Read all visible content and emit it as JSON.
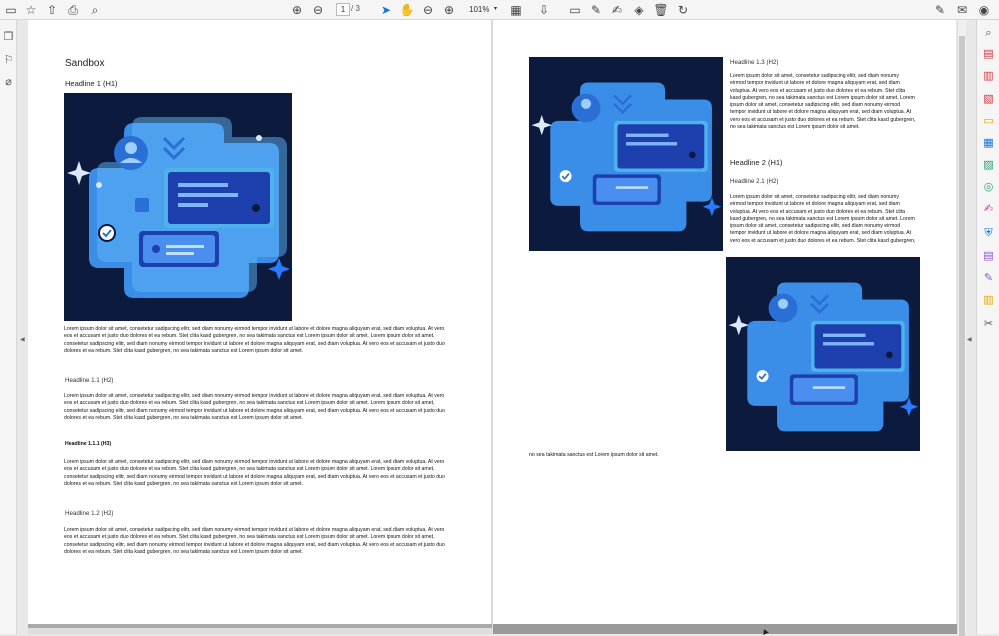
{
  "toolbar": {
    "page_current": "1",
    "page_total": "/ 3",
    "zoom": "101%",
    "zoom_caret": "▾",
    "icons": [
      "save-icon",
      "bookmark-star-icon",
      "upload-icon",
      "print-icon",
      "search-icon",
      "page-up-icon",
      "page-down-icon",
      "select-pointer-icon",
      "hand-tool-icon",
      "zoom-out-icon",
      "zoom-in-icon",
      "fit-page-icon",
      "scroll-mode-icon",
      "comment-icon",
      "highlight-pen-icon",
      "sign-icon",
      "stamp-icon",
      "delete-icon",
      "rotate-icon",
      "edit-sign-icon",
      "email-icon",
      "account-icon"
    ]
  },
  "left_panel": {
    "icons": [
      "pages-icon",
      "bookmarks-icon",
      "attachments-icon"
    ],
    "collapse_glyph": "◀"
  },
  "right_rail": {
    "icons": [
      "zoom-tool-icon",
      "create-pdf-icon",
      "combine-files-icon",
      "export-pdf-icon",
      "comment-tool-icon",
      "organize-pages-icon",
      "edit-pdf-icon",
      "scan-icon",
      "fill-sign-icon",
      "protect-icon",
      "send-for-signature-icon",
      "request-signature-icon",
      "compare-icon",
      "more-tools-icon"
    ],
    "colors": [
      "#555555",
      "#d7373f",
      "#d7373f",
      "#d7373f",
      "#e8a600",
      "#1473e6",
      "#2d9d78",
      "#2d9d78",
      "#d83790",
      "#1473e6",
      "#9256d9",
      "#9256d9",
      "#e8a600",
      "#555555"
    ],
    "collapse_glyph": "◀"
  },
  "page1": {
    "title": "Sandbox",
    "h1": "Headline 1 (H1)",
    "para1": "Lorem ipsum dolor sit amet, consetetur sadipscing elitr, sed diam nonumy eirmod tempor invidunt ut labore et dolore magna aliquyam erat, sed diam voluptua. At vero eos et accusam et justo duo dolores et ea rebum. Stet clita kasd gubergren, no sea takimata sanctus est Lorem ipsum dolor sit amet. Lorem ipsum dolor sit amet, consetetur sadipscing elitr, sed diam nonumy eirmod tempor invidunt ut labore et dolore magna aliquyam erat, sed diam voluptua. At vero eos et accusam et justo duo dolores et ea rebum. Stet clita kasd gubergren, no sea takimata sanctus est Lorem ipsum dolor sit amet.",
    "h2_1": "Headline 1.1 (H2)",
    "para2": "Lorem ipsum dolor sit amet, consetetur sadipscing elitr, sed diam nonumy eirmod tempor invidunt ut labore et dolore magna aliquyam erat, sed diam voluptua. At vero eos et accusam et justo duo dolores et ea rebum. Stet clita kasd gubergren, no sea takimata sanctus est Lorem ipsum dolor sit amet. Lorem ipsum dolor sit amet, consetetur sadipscing elitr, sed diam nonumy eirmod tempor invidunt ut labore et dolore magna aliquyam erat, sed diam voluptua. At vero eos et accusam et justo duo dolores et ea rebum. Stet clita kasd gubergren, no sea takimata sanctus est Lorem ipsum dolor sit amet.",
    "h3": "Headline 1.1.1 (H3)",
    "para3": "Lorem ipsum dolor sit amet, consetetur sadipscing elitr, sed diam nonumy eirmod tempor invidunt ut labore et dolore magna aliquyam erat, sed diam voluptua. At vero eos et accusam et justo duo dolores et ea rebum. Stet clita kasd gubergren, no sea takimata sanctus est Lorem ipsum dolor sit amet. Lorem ipsum dolor sit amet, consetetur sadipscing elitr, sed diam nonumy eirmod tempor invidunt ut labore et dolore magna aliquyam erat, sed diam voluptua. At vero eos et accusam et justo duo dolores et ea rebum. Stet clita kasd gubergren, no sea takimata sanctus est Lorem ipsum dolor sit amet.",
    "h2_2": "Headline 1.2 (H2)",
    "para4": "Lorem ipsum dolor sit amet, consetetur sadipscing elitr, sed diam nonumy eirmod tempor invidunt ut labore et dolore magna aliquyam erat, sed diam voluptua. At vero eos et accusam et justo duo dolores et ea rebum. Stet clita kasd gubergren, no sea takimata sanctus est Lorem ipsum dolor sit amet. Lorem ipsum dolor sit amet, consetetur sadipscing elitr, sed diam nonumy eirmod tempor invidunt ut labore et dolore magna aliquyam erat, sed diam voluptua. At vero eos et accusam et justo duo dolores et ea rebum. Stet clita kasd gubergren, no sea takimata sanctus est Lorem ipsum dolor sit amet."
  },
  "page2": {
    "h2_3": "Headline 1.3 (H2)",
    "para5": "Lorem ipsum dolor sit amet, consetetur sadipscing elitr, sed diam nonumy eirmod tempor invidunt ut labore et dolore magna aliquyam erat, sed diam voluptua. At vero eos et accusam et justo duo dolores et ea rebum. Stet clita kasd gubergren, no sea takimata sanctus est Lorem ipsum dolor sit amet. Lorem ipsum dolor sit amet, consetetur sadipscing elitr, sed diam nonumy eirmod tempor invidunt ut labore et dolore magna aliquyam erat, sed diam voluptua. At vero eos et accusam et justo duo dolores et ea rebum. Stet clita kasd gubergren, no sea takimata sanctus est Lorem ipsum dolor sit amet.",
    "h1_2": "Headline 2 (H1)",
    "h2_4": "Headline 2.1 (H2)",
    "para6": "Lorem ipsum dolor sit amet, consetetur sadipscing elitr, sed diam nonumy eirmod tempor invidunt ut labore et dolore magna aliquyam erat, sed diam voluptua. At vero eos et accusam et justo duo dolores et ea rebum. Stet clita kasd gubergren, no sea takimata sanctus est Lorem ipsum dolor sit amet. Lorem ipsum dolor sit amet, consetetur sadipscing elitr, sed diam nonumy eirmod tempor invidunt ut labore et dolore magna aliquyam erat, sed diam voluptua. At vero eos et accusam et justo duo dolores et ea rebum. Stet clita kasd gubergren,",
    "para7": "no sea takimata sanctus est Lorem ipsum dolor sit amet."
  },
  "colors": {
    "accent": "#1473e6",
    "illustration_bg": "#0b1a3d"
  }
}
